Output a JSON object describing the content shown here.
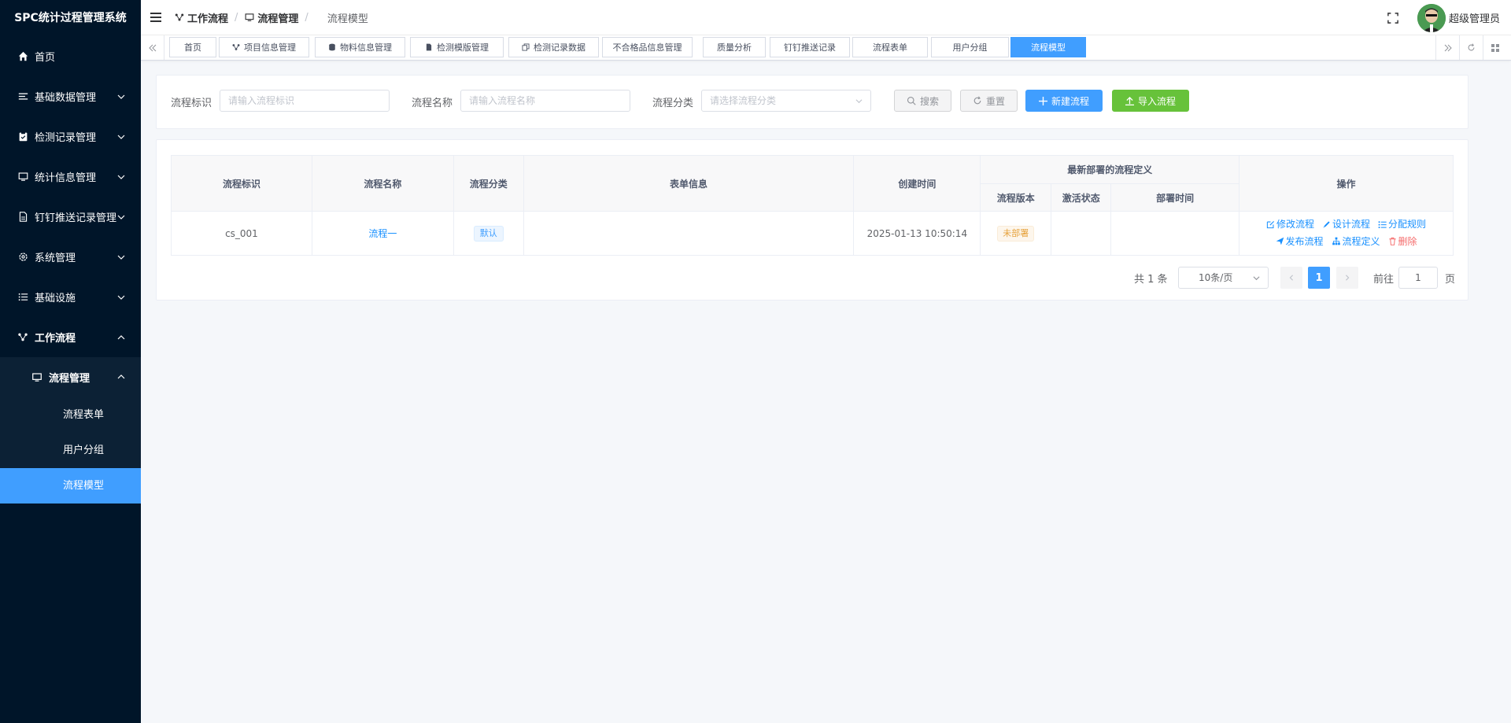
{
  "app": {
    "title": "SPC统计过程管理系统"
  },
  "sidebar": {
    "items": [
      {
        "label": "首页",
        "icon": "home-icon"
      },
      {
        "label": "基础数据管理",
        "icon": "list-icon"
      },
      {
        "label": "检测记录管理",
        "icon": "clipboard-icon"
      },
      {
        "label": "统计信息管理",
        "icon": "monitor-icon"
      },
      {
        "label": "钉钉推送记录管理",
        "icon": "document-icon"
      },
      {
        "label": "系统管理",
        "icon": "gear-icon"
      },
      {
        "label": "基础设施",
        "icon": "list-icon"
      },
      {
        "label": "工作流程",
        "icon": "flow-icon"
      }
    ],
    "submenu": {
      "label": "流程管理",
      "icon": "monitor-icon"
    },
    "subitems": [
      "流程表单",
      "用户分组",
      "流程模型"
    ]
  },
  "header": {
    "breadcrumb": [
      "工作流程",
      "流程管理",
      "流程模型"
    ],
    "user": "超级管理员"
  },
  "tabs": [
    "首页",
    "项目信息管理",
    "物料信息管理",
    "检测模版管理",
    "检测记录数据",
    "不合格品信息管理",
    "质量分析",
    "钉钉推送记录",
    "流程表单",
    "用户分组",
    "流程模型"
  ],
  "filter": {
    "key_label": "流程标识",
    "key_placeholder": "请输入流程标识",
    "name_label": "流程名称",
    "name_placeholder": "请输入流程名称",
    "cat_label": "流程分类",
    "cat_placeholder": "请选择流程分类",
    "search": "搜索",
    "reset": "重置",
    "create": "新建流程",
    "import": "导入流程"
  },
  "table": {
    "headers": {
      "key": "流程标识",
      "name": "流程名称",
      "category": "流程分类",
      "form": "表单信息",
      "created": "创建时间",
      "latest": "最新部署的流程定义",
      "version": "流程版本",
      "active": "激活状态",
      "deploy_time": "部署时间",
      "ops": "操作"
    },
    "rows": [
      {
        "key": "cs_001",
        "name": "流程一",
        "category": "默认",
        "form": "",
        "created": "2025-01-13 10:50:14",
        "version": "未部署",
        "active": "",
        "deploy_time": ""
      }
    ],
    "ops": [
      "修改流程",
      "设计流程",
      "分配规则",
      "发布流程",
      "流程定义",
      "删除"
    ]
  },
  "pagination": {
    "total": "共 1 条",
    "size": "10条/页",
    "page": "1",
    "goto": "前往",
    "goto_value": "1",
    "unit": "页"
  }
}
